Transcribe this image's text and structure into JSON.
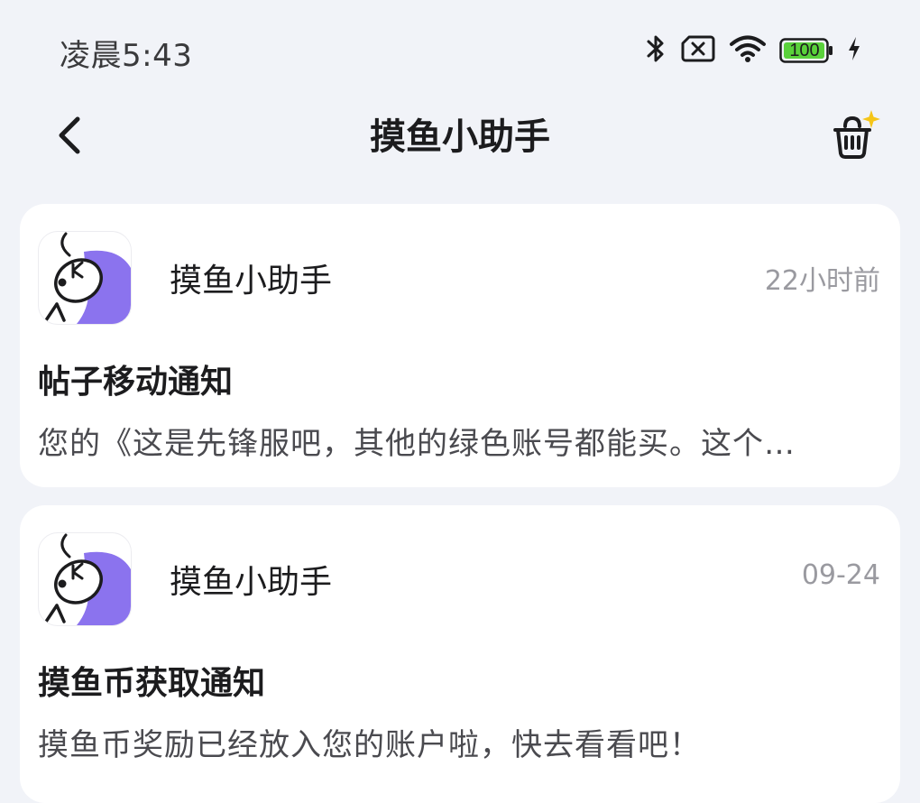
{
  "status_bar": {
    "time": "凌晨5:43",
    "battery_level": "100",
    "icons": [
      "bluetooth-icon",
      "no-sim-icon",
      "wifi-icon",
      "battery-icon",
      "charging-icon"
    ],
    "battery_color": "#5ad13b"
  },
  "nav": {
    "title": "摸鱼小助手",
    "back_icon": "chevron-left-icon",
    "action_icon": "clean-basket-icon"
  },
  "messages": [
    {
      "sender": "摸鱼小助手",
      "time": "22小时前",
      "title": "帖子移动通知",
      "body": "您的《这是先锋服吧，其他的绿色账号都能买。这个…"
    },
    {
      "sender": "摸鱼小助手",
      "time": "09-24",
      "title": "摸鱼币获取通知",
      "body": "摸鱼币奖励已经放入您的账户啦，快去看看吧！"
    }
  ],
  "colors": {
    "background": "#f1f3f8",
    "card": "#ffffff",
    "avatar_accent": "#8b73ee",
    "sparkle": "#f5c518"
  }
}
